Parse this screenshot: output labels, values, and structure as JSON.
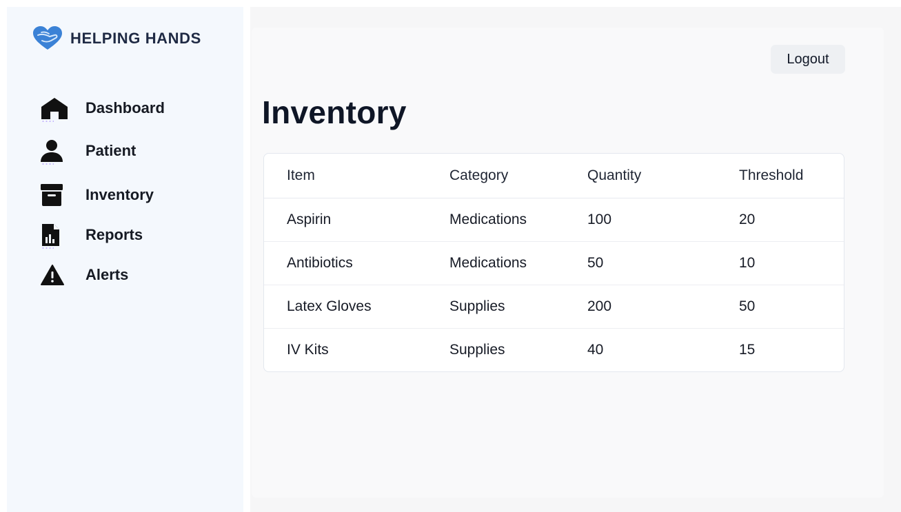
{
  "brand": {
    "name": "HELPING HANDS",
    "logo_icon": "heart-hand-icon",
    "accent": "#3b82d6"
  },
  "sidebar": {
    "items": [
      {
        "label": "Dashboard",
        "icon": "home-icon"
      },
      {
        "label": "Patient",
        "icon": "user-icon"
      },
      {
        "label": "Inventory",
        "icon": "archive-box-icon"
      },
      {
        "label": "Reports",
        "icon": "report-document-icon"
      },
      {
        "label": "Alerts",
        "icon": "warning-triangle-icon"
      }
    ]
  },
  "header": {
    "logout_label": "Logout"
  },
  "main": {
    "title": "Inventory",
    "table": {
      "columns": [
        "Item",
        "Category",
        "Quantity",
        "Threshold"
      ],
      "rows": [
        [
          "Aspirin",
          "Medications",
          "100",
          "20"
        ],
        [
          "Antibiotics",
          "Medications",
          "50",
          "10"
        ],
        [
          "Latex Gloves",
          "Supplies",
          "200",
          "50"
        ],
        [
          "IV Kits",
          "Supplies",
          "40",
          "15"
        ]
      ]
    }
  }
}
